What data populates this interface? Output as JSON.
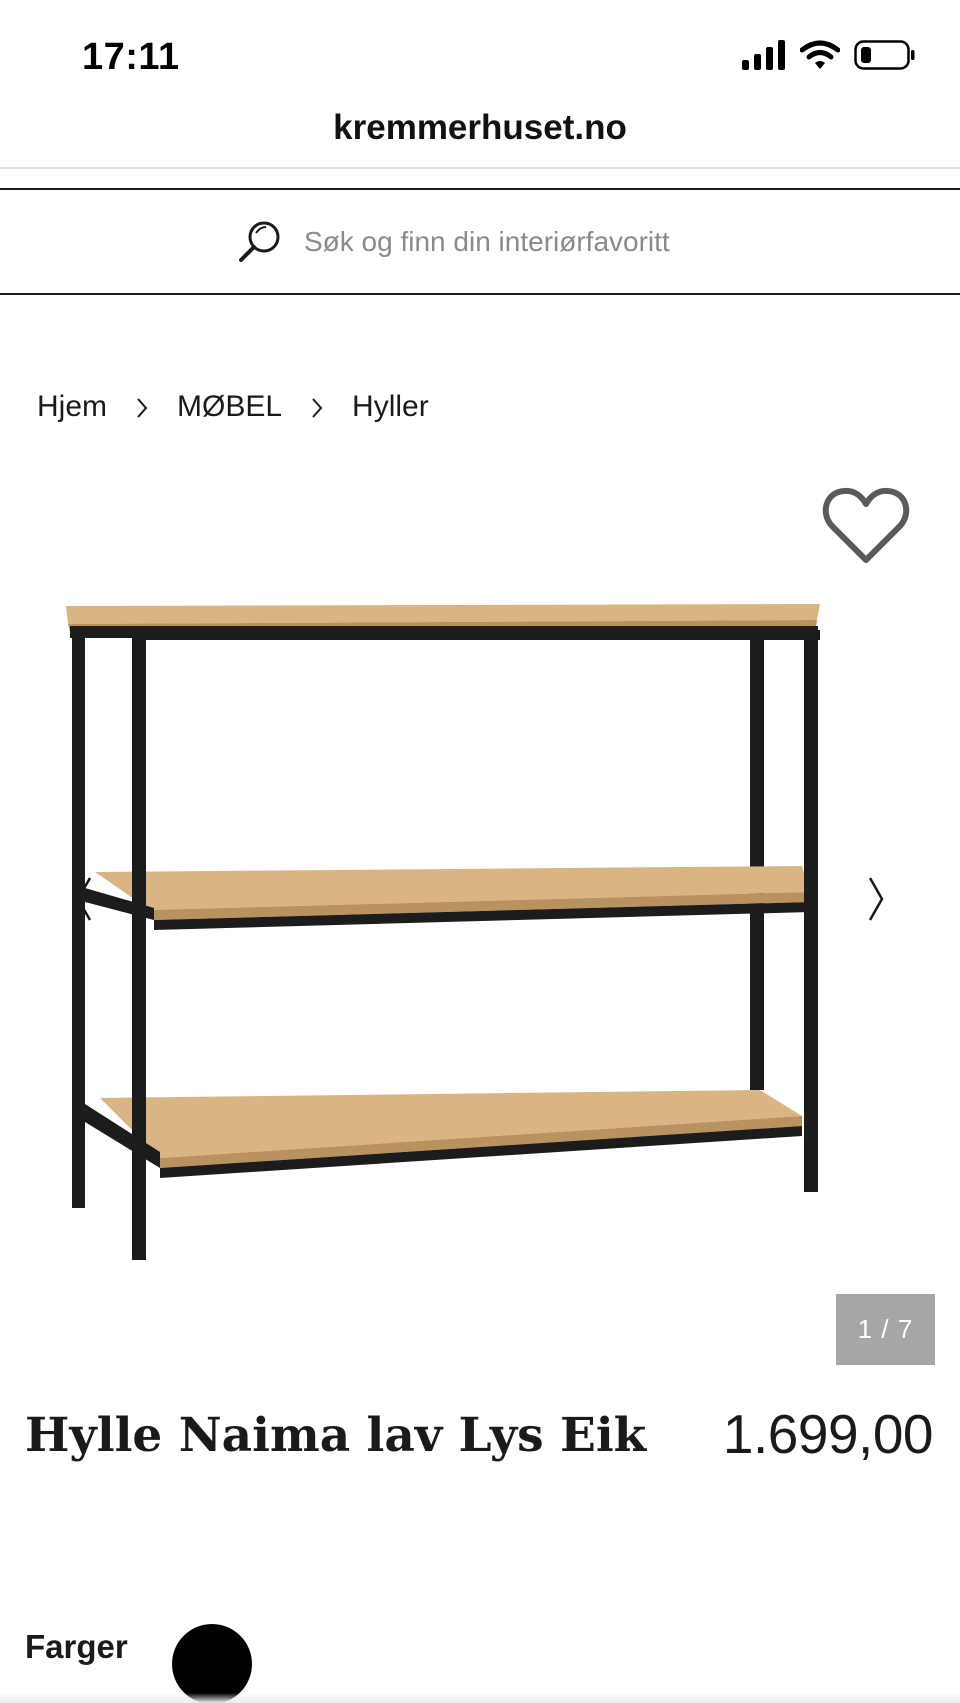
{
  "status_bar": {
    "time": "17:11"
  },
  "browser": {
    "url": "kremmerhuset.no"
  },
  "search": {
    "placeholder": "Søk og finn din interiørfavoritt",
    "icon": "search-icon"
  },
  "breadcrumb": {
    "items": [
      "Hjem",
      "MØBEL",
      "Hyller"
    ]
  },
  "gallery": {
    "counter": "1 / 7"
  },
  "product": {
    "title": "Hylle Naima lav Lys Eik",
    "price": "1.699,00"
  },
  "colors": {
    "label": "Farger",
    "swatches": [
      "#000000"
    ]
  },
  "theme": {
    "text": "#1a1a1a",
    "counter_bg": "#a6a6a6",
    "wood": "#d9b584"
  }
}
